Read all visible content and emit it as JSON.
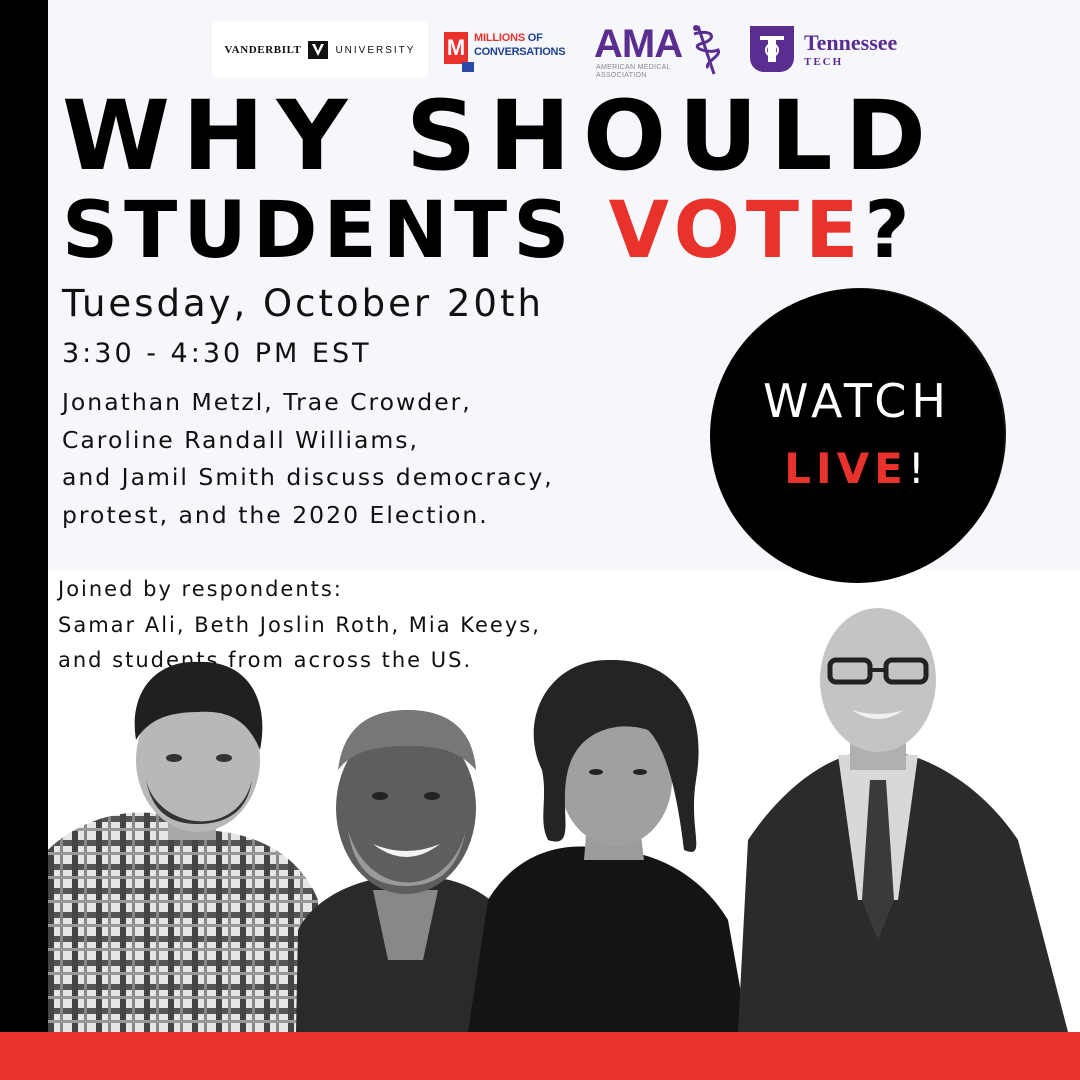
{
  "logos": {
    "vanderbilt": {
      "word1": "VANDERBILT",
      "word2": "UNIVERSITY"
    },
    "millions": {
      "m": "M",
      "line1a": "MILLIONS",
      "line1b": " OF",
      "line2": "CONVERSATIONS"
    },
    "ama": {
      "word": "AMA",
      "sub": "AMERICAN MEDICAL ASSOCIATION"
    },
    "tennessee": {
      "name": "Tennessee",
      "sub": "TECH"
    }
  },
  "headline": {
    "line1": "WHY SHOULD",
    "line2_prefix": "STUDENTS ",
    "line2_highlight": "VOTE",
    "line2_suffix": "?"
  },
  "event": {
    "date": "Tuesday, October 20th",
    "time": "3:30 - 4:30 PM EST",
    "description_lines": [
      "Jonathan Metzl, Trae Crowder,",
      "Caroline Randall Williams,",
      "and Jamil Smith discuss democracy,",
      "protest, and the 2020 Election."
    ],
    "respondents_lines": [
      "Joined by respondents:",
      "Samar Ali, Beth Joslin Roth, Mia Keeys,",
      "and students from across the US."
    ]
  },
  "cta": {
    "line1": "WATCH",
    "line2": "LIVE",
    "exclaim": "!"
  },
  "colors": {
    "accent": "#e8322b",
    "black": "#000000",
    "purple": "#5a2d91",
    "blue": "#1f3f8f"
  }
}
